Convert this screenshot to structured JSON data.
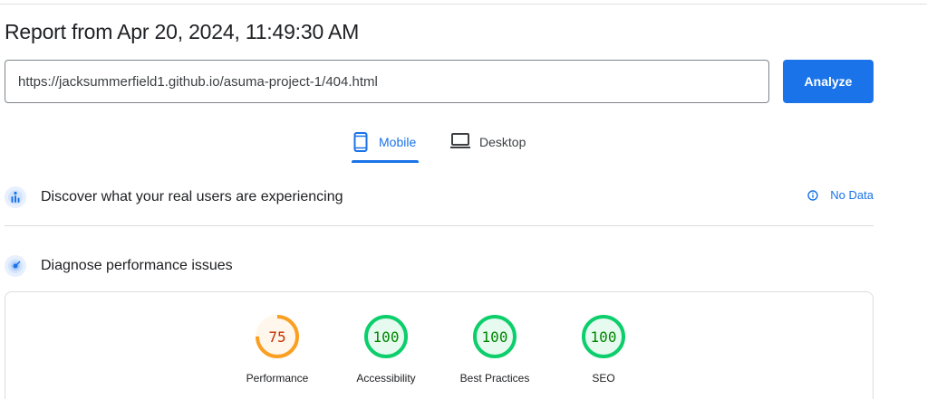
{
  "report": {
    "title": "Report from Apr 20, 2024, 11:49:30 AM"
  },
  "search": {
    "url_value": "https://jacksummerfield1.github.io/asuma-project-1/404.html",
    "analyze_label": "Analyze"
  },
  "tabs": {
    "mobile_label": "Mobile",
    "desktop_label": "Desktop",
    "active": "Mobile"
  },
  "field_data": {
    "heading": "Discover what your real users are experiencing",
    "status_label": "No Data"
  },
  "lab_data": {
    "heading": "Diagnose performance issues"
  },
  "scores": [
    {
      "label": "Performance",
      "value": "75",
      "score": 75,
      "color": "#fa9f21",
      "text_color": "#c33300",
      "fill_color": "#fff7ec"
    },
    {
      "label": "Accessibility",
      "value": "100",
      "score": 100,
      "color": "#0cce6b",
      "text_color": "#008800",
      "fill_color": "#e6faf0"
    },
    {
      "label": "Best Practices",
      "value": "100",
      "score": 100,
      "color": "#0cce6b",
      "text_color": "#008800",
      "fill_color": "#e6faf0"
    },
    {
      "label": "SEO",
      "value": "100",
      "score": 100,
      "color": "#0cce6b",
      "text_color": "#008800",
      "fill_color": "#e6faf0"
    }
  ],
  "colors": {
    "accent": "#1a73e8",
    "good": "#0cce6b",
    "average": "#fa9f21"
  },
  "icons": {
    "mobile": "smartphone-icon",
    "desktop": "laptop-icon",
    "field_data": "real-users-icon",
    "lab_data": "diagnose-icon",
    "status": "info-icon"
  }
}
